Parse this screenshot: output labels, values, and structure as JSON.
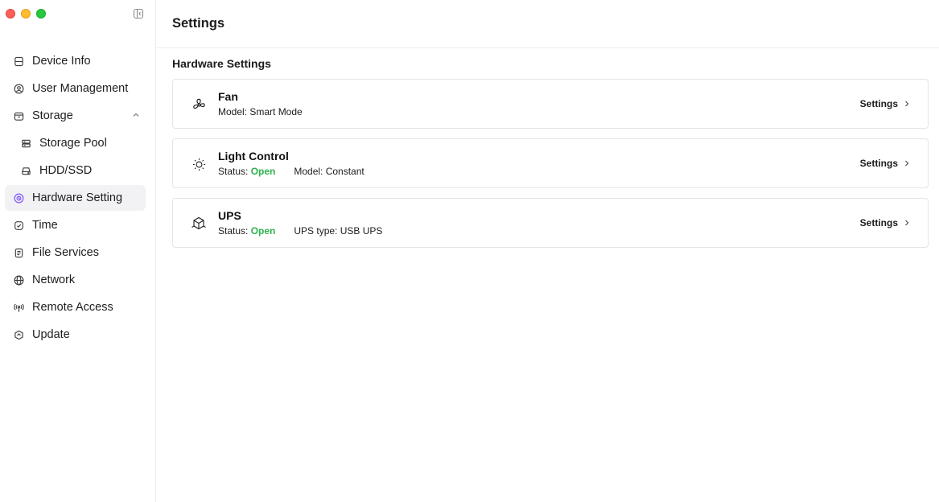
{
  "window": {
    "traffic_lights": [
      "close",
      "minimize",
      "zoom"
    ]
  },
  "sidebar": {
    "items": [
      {
        "label": "Device Info",
        "icon": "device-icon"
      },
      {
        "label": "User Management",
        "icon": "user-icon"
      },
      {
        "label": "Storage",
        "icon": "storage-icon",
        "expanded": true
      },
      {
        "label": "Storage Pool",
        "icon": "storage-pool-icon",
        "sub": true
      },
      {
        "label": "HDD/SSD",
        "icon": "hdd-icon",
        "sub": true
      },
      {
        "label": "Hardware Setting",
        "icon": "hardware-icon",
        "active": true
      },
      {
        "label": "Time",
        "icon": "clock-icon"
      },
      {
        "label": "File Services",
        "icon": "file-icon"
      },
      {
        "label": "Network",
        "icon": "globe-icon"
      },
      {
        "label": "Remote Access",
        "icon": "antenna-icon"
      },
      {
        "label": "Update",
        "icon": "update-icon"
      }
    ]
  },
  "header": {
    "title": "Settings"
  },
  "main": {
    "section_title": "Hardware Settings",
    "cards": [
      {
        "name": "Fan",
        "icon": "fan-icon",
        "model": "Model: Smart Mode",
        "settings_label": "Settings"
      },
      {
        "name": "Light Control",
        "icon": "sun-icon",
        "status_prefix": "Status: ",
        "status_value": "Open",
        "model": "Model: Constant",
        "settings_label": "Settings"
      },
      {
        "name": "UPS",
        "icon": "ups-icon",
        "status_prefix": "Status: ",
        "status_value": "Open",
        "model": "UPS type: USB UPS",
        "settings_label": "Settings"
      }
    ]
  },
  "colors": {
    "status_open": "#2bb24c",
    "accent": "#7c4dff",
    "active_bg": "#f2f2f4"
  }
}
